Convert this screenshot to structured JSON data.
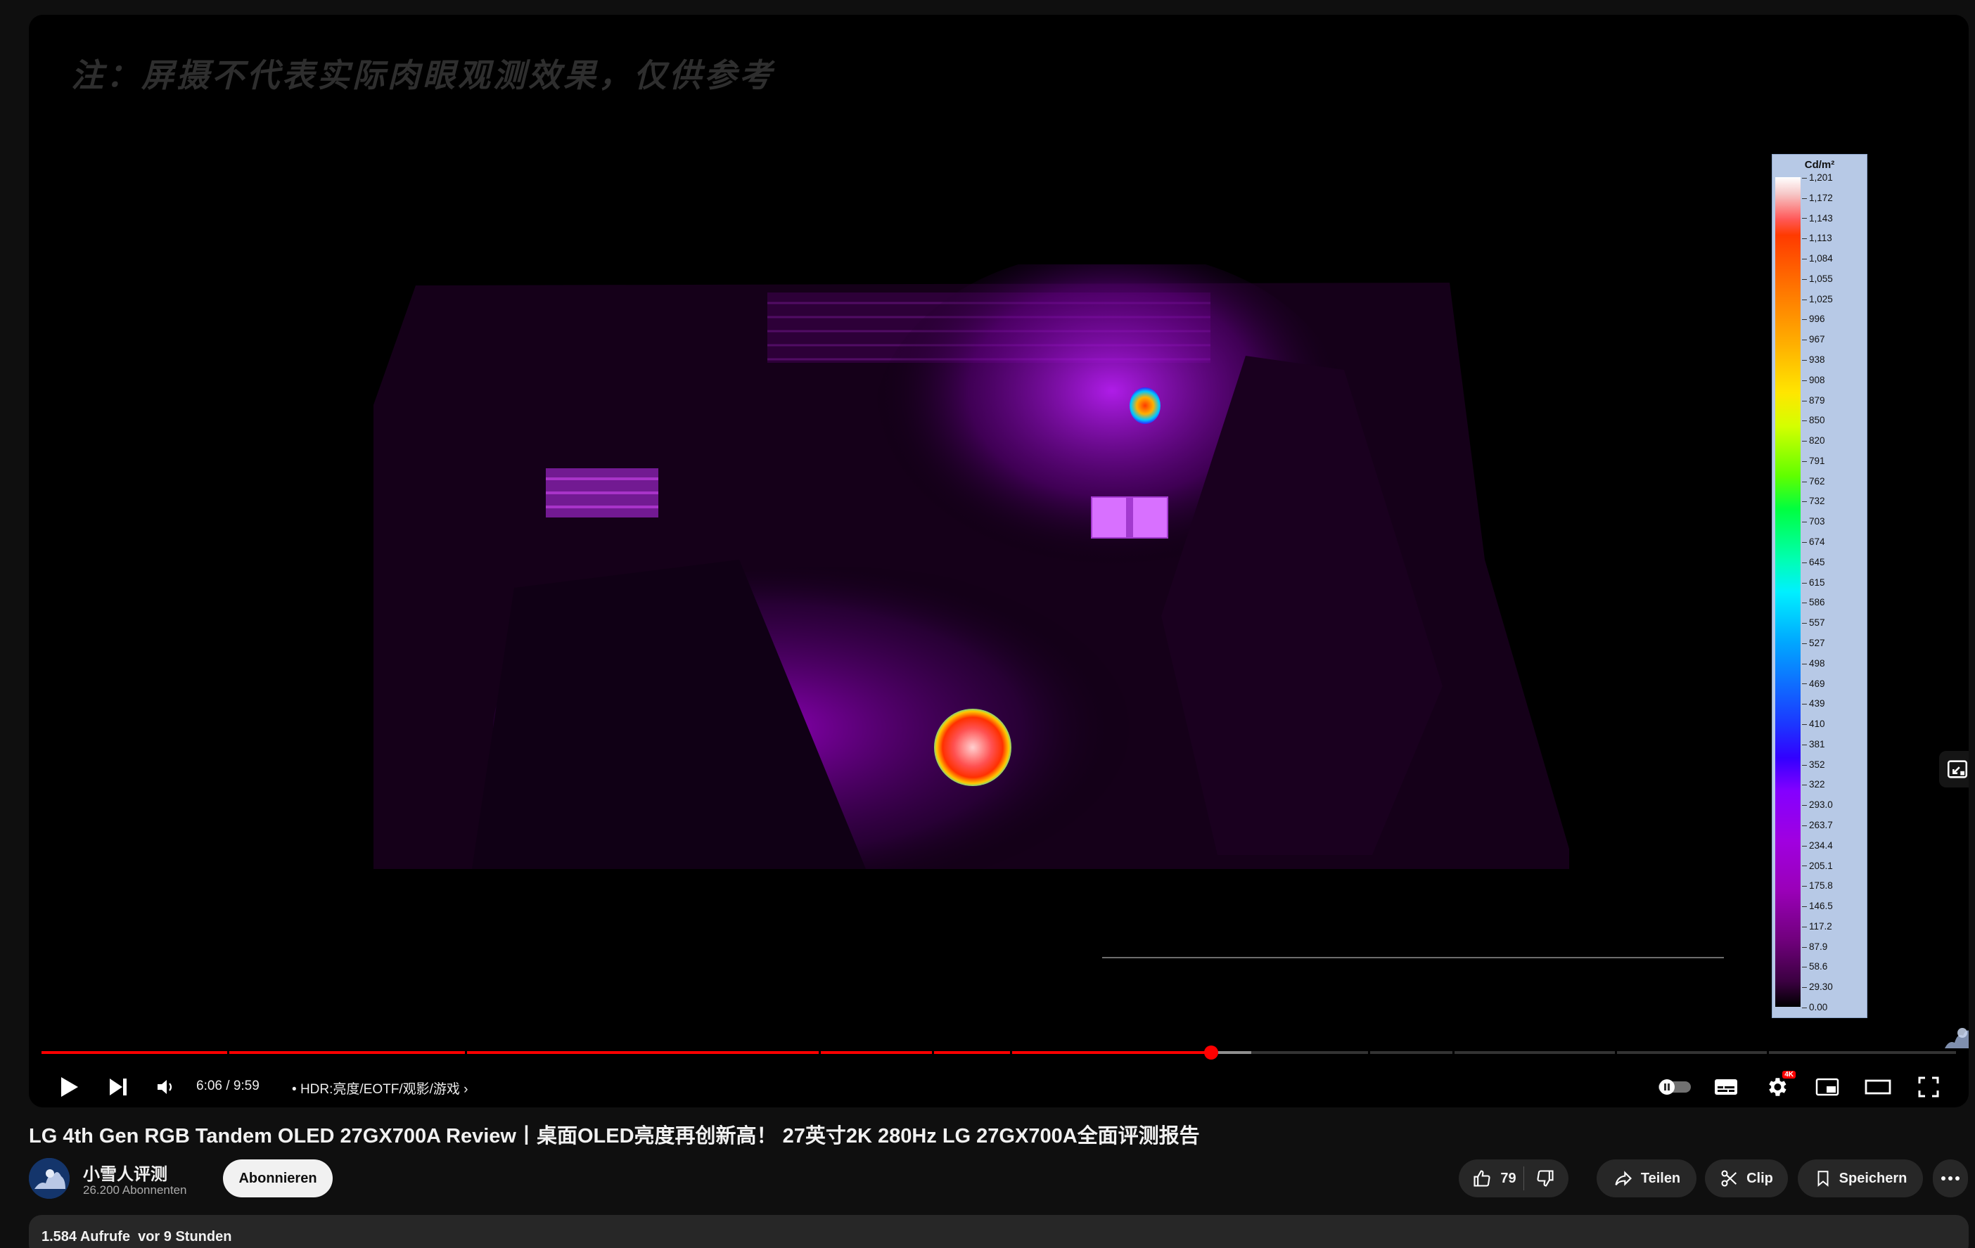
{
  "player": {
    "overlay_note": "注：屏摄不代表实际肉眼观测效果，仅供参考",
    "time": "6:06 / 9:59",
    "chapter": "HDR:亮度/EOTF/观影/游戏",
    "progress_fraction": 0.6108,
    "buffer_fraction": 0.632,
    "chapter_marks": [
      0.097,
      0.221,
      0.406,
      0.465,
      0.506,
      0.693,
      0.737,
      0.822,
      0.901
    ],
    "quality_badge": "4K",
    "colorscale": {
      "unit": "Cd/m²",
      "ticks": [
        "1,201",
        "1,172",
        "1,143",
        "1,113",
        "1,084",
        "1,055",
        "1,025",
        "996",
        "967",
        "938",
        "908",
        "879",
        "850",
        "820",
        "791",
        "762",
        "732",
        "703",
        "674",
        "645",
        "615",
        "586",
        "557",
        "527",
        "498",
        "469",
        "439",
        "410",
        "381",
        "352",
        "322",
        "293.0",
        "263.7",
        "234.4",
        "205.1",
        "175.8",
        "146.5",
        "117.2",
        "87.9",
        "58.6",
        "29.30",
        "0.00"
      ]
    }
  },
  "video": {
    "title": "LG 4th Gen RGB Tandem OLED 27GX700A Review丨桌面OLED亮度再创新高！ 27英寸2K 280Hz LG 27GX700A全面评测报告"
  },
  "channel": {
    "name": "小雪人评测",
    "subscribers": "26.200 Abonnenten",
    "subscribe_label": "Abonnieren"
  },
  "actions": {
    "likes": "79",
    "share": "Teilen",
    "clip": "Clip",
    "save": "Speichern"
  },
  "description": {
    "views": "1.584 Aufrufe",
    "age": "vor 9 Stunden"
  },
  "colors": {
    "accent": "#ff0000",
    "background": "#0f0f0f",
    "pill": "#272727"
  }
}
